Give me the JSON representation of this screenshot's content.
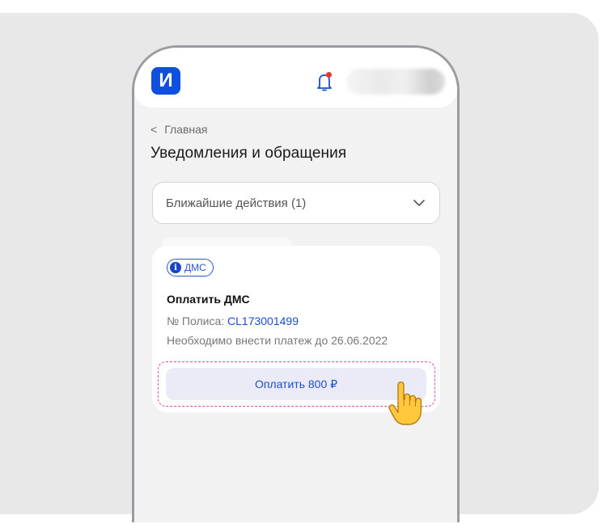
{
  "header": {
    "logo_letter": "И"
  },
  "breadcrumb": {
    "back_label": "Главная"
  },
  "page": {
    "title": "Уведомления и обращения"
  },
  "filter": {
    "selected": "Ближайшие действия (1)"
  },
  "card": {
    "badge": "ДМС",
    "title": "Оплатить ДМС",
    "policy_label": "№ Полиса: ",
    "policy_number": "CL173001499",
    "due_text": "Необходимо внести платеж до 26.06.2022",
    "pay_button": "Оплатить 800 ₽"
  },
  "colors": {
    "brand": "#0f4fe0",
    "link": "#1a4fd1",
    "highlight_outline": "#d94fb2",
    "notification_dot": "#e8392f"
  },
  "icons": {
    "bell": "bell-icon",
    "back": "chevron-left-icon",
    "dropdown": "chevron-down-icon",
    "info": "info-icon",
    "pointer": "pointing-hand-icon"
  }
}
